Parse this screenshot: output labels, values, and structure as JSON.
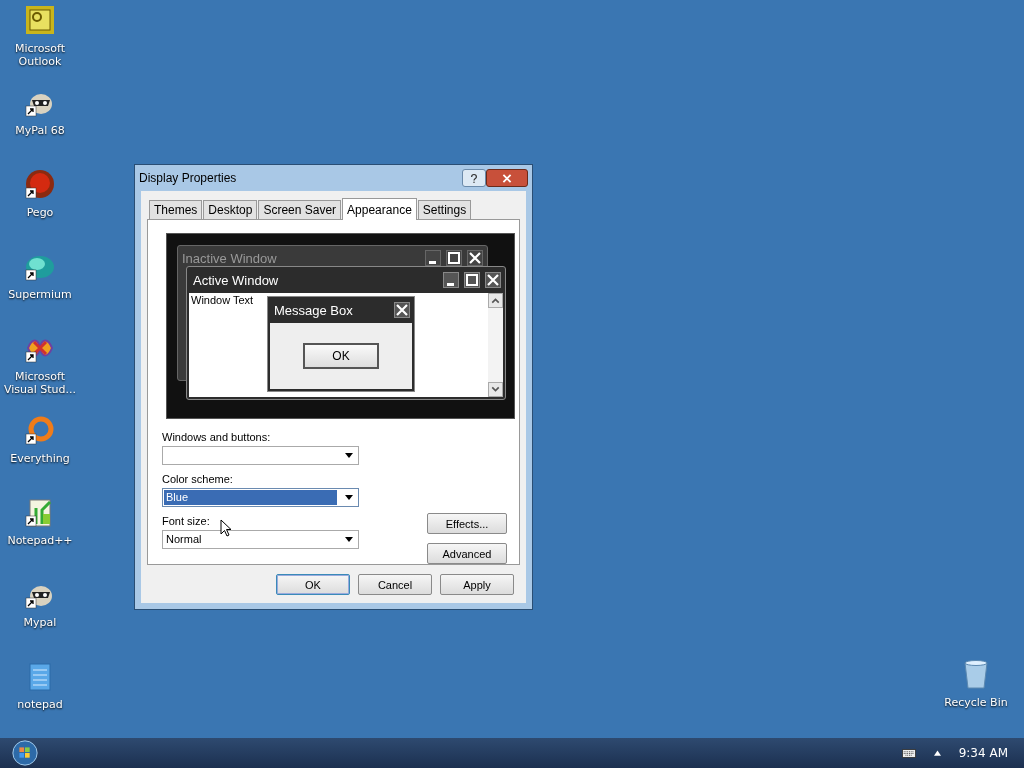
{
  "desktop_icons": [
    {
      "label": "Microsoft Outlook",
      "kind": "outlook",
      "shortcut": false
    },
    {
      "label": "MyPal 68",
      "kind": "raccoon",
      "shortcut": true
    },
    {
      "label": "Pego",
      "kind": "pego",
      "shortcut": true
    },
    {
      "label": "Supermium",
      "kind": "supermium",
      "shortcut": true
    },
    {
      "label": "Microsoft Visual Stud...",
      "kind": "vs",
      "shortcut": true
    },
    {
      "label": "Everything",
      "kind": "everything",
      "shortcut": true
    },
    {
      "label": "Notepad++",
      "kind": "notepadpp",
      "shortcut": true
    },
    {
      "label": "Mypal",
      "kind": "raccoon",
      "shortcut": true
    },
    {
      "label": "notepad",
      "kind": "notepad",
      "shortcut": false
    }
  ],
  "recycle_bin": {
    "label": "Recycle Bin"
  },
  "dialog": {
    "title": "Display Properties",
    "tabs": [
      {
        "label": "Themes",
        "selected": false
      },
      {
        "label": "Desktop",
        "selected": false
      },
      {
        "label": "Screen Saver",
        "selected": false
      },
      {
        "label": "Appearance",
        "selected": true
      },
      {
        "label": "Settings",
        "selected": false
      }
    ],
    "preview": {
      "inactive_title": "Inactive Window",
      "active_title": "Active Window",
      "window_text": "Window Text",
      "message_box_title": "Message Box",
      "message_box_button": "OK"
    },
    "fields": [
      {
        "label": "Windows and buttons:"
      },
      {
        "label": "Color scheme:",
        "value": "Blue",
        "highlighted": true
      },
      {
        "label": "Font size:",
        "value": "Normal",
        "highlighted": false
      }
    ],
    "side_buttons": [
      "Effects...",
      "Advanced"
    ],
    "buttons": [
      {
        "label": "OK",
        "default": true
      },
      {
        "label": "Cancel",
        "default": false
      },
      {
        "label": "Apply",
        "default": false
      }
    ]
  },
  "taskbar": {
    "clock": "9:34 AM"
  }
}
